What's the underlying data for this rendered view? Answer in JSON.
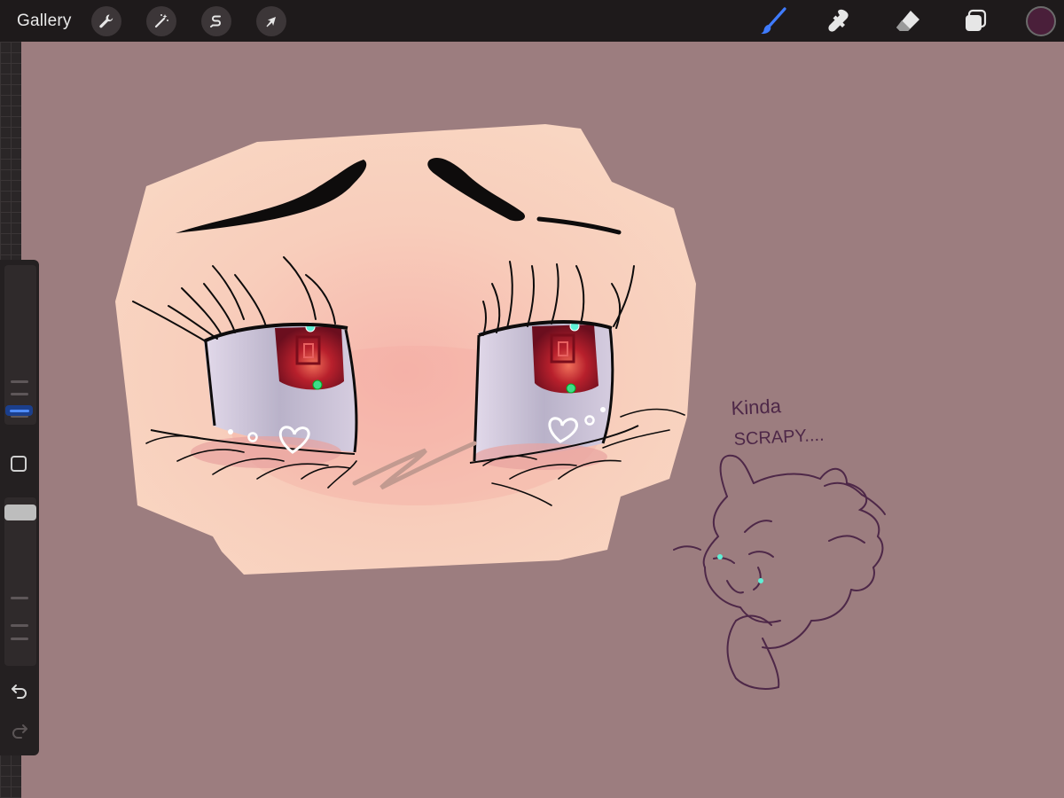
{
  "topbar": {
    "gallery_label": "Gallery",
    "tools_left": [
      {
        "name": "actions",
        "icon": "wrench-icon"
      },
      {
        "name": "adjustments",
        "icon": "magic-wand-icon"
      },
      {
        "name": "selection",
        "icon": "selection-s-icon"
      },
      {
        "name": "transform",
        "icon": "arrow-cursor-icon"
      }
    ],
    "tools_right": [
      {
        "name": "brush",
        "icon": "brush-icon",
        "active": true
      },
      {
        "name": "smudge",
        "icon": "smudge-icon"
      },
      {
        "name": "eraser",
        "icon": "eraser-icon"
      },
      {
        "name": "layers",
        "icon": "layers-icon"
      }
    ],
    "current_color": "#4a1f3a",
    "active_tool_color": "#3f7bff"
  },
  "sidebar": {
    "brush_size_icon": "size-slider",
    "modifier_icon": "square-modifier-icon",
    "opacity_icon": "opacity-slider",
    "undo_icon": "undo-icon",
    "redo_icon": "redo-icon"
  },
  "canvas": {
    "background_color": "#9c7d7f",
    "skin_color": "#f8cdbb",
    "iris_color": "#b0222e",
    "sclera_color": "#c9c3d6",
    "line_color": "#111111",
    "doodle_color": "#4e2848",
    "note_text": [
      "Kinda",
      "SCRAPY...."
    ]
  }
}
